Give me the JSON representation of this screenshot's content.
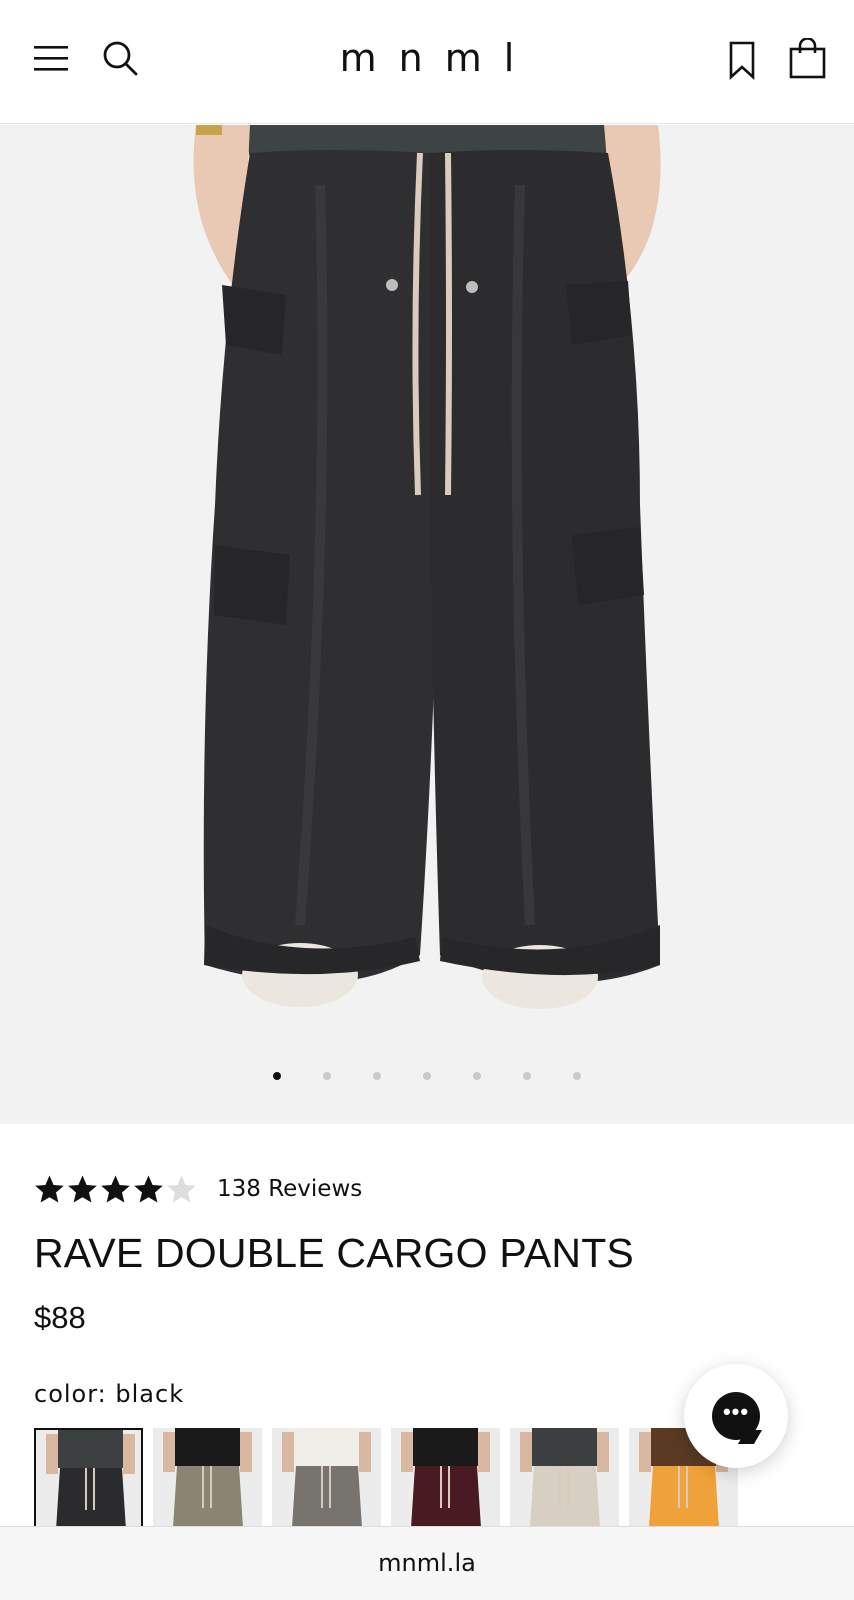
{
  "header": {
    "logo": "mnml",
    "icons": [
      "menu-icon",
      "search-icon",
      "bookmark-icon",
      "shopping-bag-icon"
    ]
  },
  "gallery": {
    "image_count": 7,
    "active_index": 0
  },
  "product": {
    "rating": 4,
    "rating_max": 5,
    "reviews_label": "138 Reviews",
    "title": "RAVE DOUBLE CARGO PANTS",
    "price": "$88",
    "color_label": "color: black",
    "swatches": [
      {
        "name": "black",
        "shirt": "#3c4040",
        "pants": "#2b2b2d"
      },
      {
        "name": "olive",
        "shirt": "#1a1a1a",
        "pants": "#8a8572"
      },
      {
        "name": "grey",
        "shirt": "#f0eee8",
        "pants": "#77736e"
      },
      {
        "name": "burgundy",
        "shirt": "#1a1a1a",
        "pants": "#4a1a22"
      },
      {
        "name": "cream",
        "shirt": "#3b3f40",
        "pants": "#d6cfc2"
      },
      {
        "name": "orange",
        "shirt": "#5a3a22",
        "pants": "#f0a23a"
      }
    ]
  },
  "chat": {
    "icon": "chat-bubble-icon",
    "glyph": "•••"
  },
  "browser": {
    "url": "mnml.la"
  },
  "colors": {
    "star_filled": "#111111",
    "star_empty": "#dddddd",
    "hero_bg": "#f2f2f2",
    "pants": "#2f2f31"
  }
}
